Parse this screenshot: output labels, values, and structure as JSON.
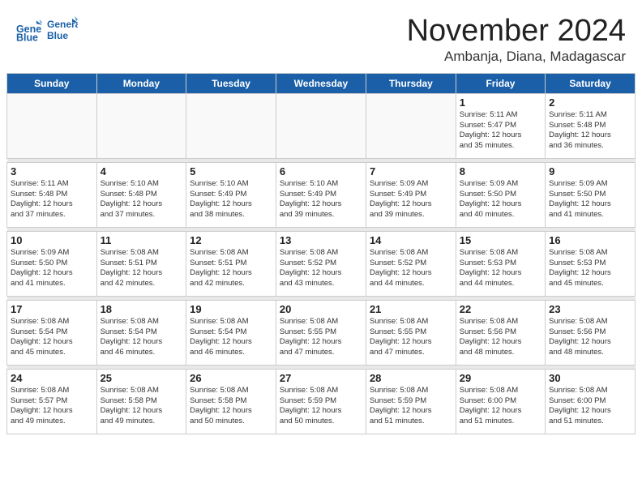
{
  "logo": {
    "line1": "General",
    "line2": "Blue"
  },
  "title": "November 2024",
  "location": "Ambanja, Diana, Madagascar",
  "days_of_week": [
    "Sunday",
    "Monday",
    "Tuesday",
    "Wednesday",
    "Thursday",
    "Friday",
    "Saturday"
  ],
  "weeks": [
    [
      {
        "day": "",
        "info": ""
      },
      {
        "day": "",
        "info": ""
      },
      {
        "day": "",
        "info": ""
      },
      {
        "day": "",
        "info": ""
      },
      {
        "day": "",
        "info": ""
      },
      {
        "day": "1",
        "info": "Sunrise: 5:11 AM\nSunset: 5:47 PM\nDaylight: 12 hours\nand 35 minutes."
      },
      {
        "day": "2",
        "info": "Sunrise: 5:11 AM\nSunset: 5:48 PM\nDaylight: 12 hours\nand 36 minutes."
      }
    ],
    [
      {
        "day": "3",
        "info": "Sunrise: 5:11 AM\nSunset: 5:48 PM\nDaylight: 12 hours\nand 37 minutes."
      },
      {
        "day": "4",
        "info": "Sunrise: 5:10 AM\nSunset: 5:48 PM\nDaylight: 12 hours\nand 37 minutes."
      },
      {
        "day": "5",
        "info": "Sunrise: 5:10 AM\nSunset: 5:49 PM\nDaylight: 12 hours\nand 38 minutes."
      },
      {
        "day": "6",
        "info": "Sunrise: 5:10 AM\nSunset: 5:49 PM\nDaylight: 12 hours\nand 39 minutes."
      },
      {
        "day": "7",
        "info": "Sunrise: 5:09 AM\nSunset: 5:49 PM\nDaylight: 12 hours\nand 39 minutes."
      },
      {
        "day": "8",
        "info": "Sunrise: 5:09 AM\nSunset: 5:50 PM\nDaylight: 12 hours\nand 40 minutes."
      },
      {
        "day": "9",
        "info": "Sunrise: 5:09 AM\nSunset: 5:50 PM\nDaylight: 12 hours\nand 41 minutes."
      }
    ],
    [
      {
        "day": "10",
        "info": "Sunrise: 5:09 AM\nSunset: 5:50 PM\nDaylight: 12 hours\nand 41 minutes."
      },
      {
        "day": "11",
        "info": "Sunrise: 5:08 AM\nSunset: 5:51 PM\nDaylight: 12 hours\nand 42 minutes."
      },
      {
        "day": "12",
        "info": "Sunrise: 5:08 AM\nSunset: 5:51 PM\nDaylight: 12 hours\nand 42 minutes."
      },
      {
        "day": "13",
        "info": "Sunrise: 5:08 AM\nSunset: 5:52 PM\nDaylight: 12 hours\nand 43 minutes."
      },
      {
        "day": "14",
        "info": "Sunrise: 5:08 AM\nSunset: 5:52 PM\nDaylight: 12 hours\nand 44 minutes."
      },
      {
        "day": "15",
        "info": "Sunrise: 5:08 AM\nSunset: 5:53 PM\nDaylight: 12 hours\nand 44 minutes."
      },
      {
        "day": "16",
        "info": "Sunrise: 5:08 AM\nSunset: 5:53 PM\nDaylight: 12 hours\nand 45 minutes."
      }
    ],
    [
      {
        "day": "17",
        "info": "Sunrise: 5:08 AM\nSunset: 5:54 PM\nDaylight: 12 hours\nand 45 minutes."
      },
      {
        "day": "18",
        "info": "Sunrise: 5:08 AM\nSunset: 5:54 PM\nDaylight: 12 hours\nand 46 minutes."
      },
      {
        "day": "19",
        "info": "Sunrise: 5:08 AM\nSunset: 5:54 PM\nDaylight: 12 hours\nand 46 minutes."
      },
      {
        "day": "20",
        "info": "Sunrise: 5:08 AM\nSunset: 5:55 PM\nDaylight: 12 hours\nand 47 minutes."
      },
      {
        "day": "21",
        "info": "Sunrise: 5:08 AM\nSunset: 5:55 PM\nDaylight: 12 hours\nand 47 minutes."
      },
      {
        "day": "22",
        "info": "Sunrise: 5:08 AM\nSunset: 5:56 PM\nDaylight: 12 hours\nand 48 minutes."
      },
      {
        "day": "23",
        "info": "Sunrise: 5:08 AM\nSunset: 5:56 PM\nDaylight: 12 hours\nand 48 minutes."
      }
    ],
    [
      {
        "day": "24",
        "info": "Sunrise: 5:08 AM\nSunset: 5:57 PM\nDaylight: 12 hours\nand 49 minutes."
      },
      {
        "day": "25",
        "info": "Sunrise: 5:08 AM\nSunset: 5:58 PM\nDaylight: 12 hours\nand 49 minutes."
      },
      {
        "day": "26",
        "info": "Sunrise: 5:08 AM\nSunset: 5:58 PM\nDaylight: 12 hours\nand 50 minutes."
      },
      {
        "day": "27",
        "info": "Sunrise: 5:08 AM\nSunset: 5:59 PM\nDaylight: 12 hours\nand 50 minutes."
      },
      {
        "day": "28",
        "info": "Sunrise: 5:08 AM\nSunset: 5:59 PM\nDaylight: 12 hours\nand 51 minutes."
      },
      {
        "day": "29",
        "info": "Sunrise: 5:08 AM\nSunset: 6:00 PM\nDaylight: 12 hours\nand 51 minutes."
      },
      {
        "day": "30",
        "info": "Sunrise: 5:08 AM\nSunset: 6:00 PM\nDaylight: 12 hours\nand 51 minutes."
      }
    ]
  ]
}
